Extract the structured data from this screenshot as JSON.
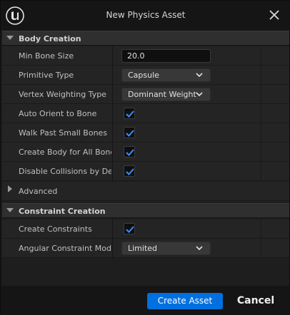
{
  "window": {
    "title": "New Physics Asset"
  },
  "sections": {
    "body_creation": "Body Creation",
    "advanced": "Advanced",
    "constraint_creation": "Constraint Creation"
  },
  "body_creation": {
    "min_bone_size": {
      "label": "Min Bone Size",
      "value": "20.0"
    },
    "primitive_type": {
      "label": "Primitive Type",
      "value": "Capsule"
    },
    "vertex_weighting_type": {
      "label": "Vertex Weighting Type",
      "value": "Dominant Weight"
    },
    "auto_orient_to_bone": {
      "label": "Auto Orient to Bone",
      "checked": true
    },
    "walk_past_small_bones": {
      "label": "Walk Past Small Bones",
      "checked": true
    },
    "create_body_for_all_bones": {
      "label": "Create Body for All Bones",
      "checked": true
    },
    "disable_collisions": {
      "label": "Disable Collisions by De...",
      "checked": true
    }
  },
  "constraint_creation": {
    "create_constraints": {
      "label": "Create Constraints",
      "checked": true
    },
    "angular_constraint_mode": {
      "label": "Angular Constraint Mode",
      "value": "Limited"
    }
  },
  "footer": {
    "create_asset": "Create Asset",
    "cancel": "Cancel"
  },
  "colors": {
    "accent": "#0070e0",
    "check": "#3d8bff",
    "background": "#1a1a1a"
  }
}
